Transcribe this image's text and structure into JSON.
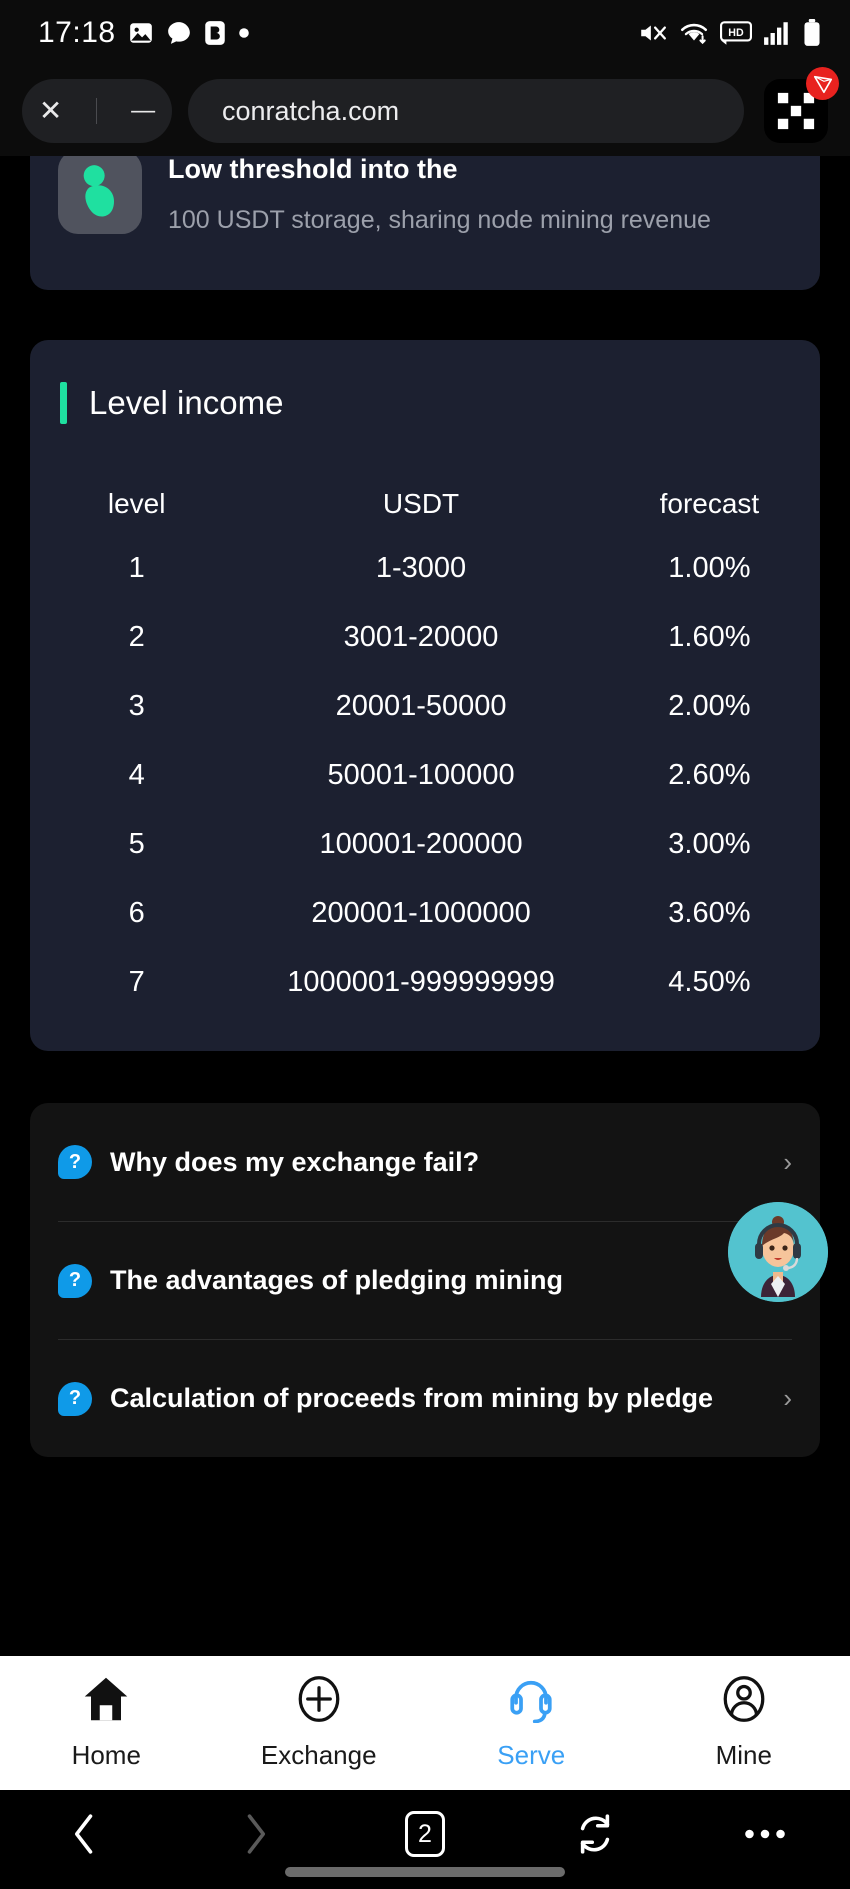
{
  "statusbar": {
    "time": "17:18",
    "left_icons": [
      "photo-icon",
      "chat-icon",
      "b-app-icon",
      "dot-icon"
    ],
    "right_icons": [
      "mute-icon",
      "wifi-icon",
      "hd-icon",
      "signal-icon",
      "battery-icon"
    ]
  },
  "browser_top": {
    "close_label": "✕",
    "minimize_label": "—",
    "url": "conratcha.com",
    "app_launcher_name": "qr-app-icon",
    "badge_name": "tron-badge-icon"
  },
  "promo_card": {
    "title": "Low threshold into the",
    "subtitle": "100 USDT storage, sharing node mining revenue",
    "icon": "person-mining-icon"
  },
  "level_income": {
    "title": "Level income",
    "accent_color": "#1fe0a0"
  },
  "chart_data": {
    "type": "table",
    "title": "Level income",
    "columns": [
      "level",
      "USDT",
      "forecast"
    ],
    "rows": [
      [
        "1",
        "1-3000",
        "1.00%"
      ],
      [
        "2",
        "3001-20000",
        "1.60%"
      ],
      [
        "3",
        "20001-50000",
        "2.00%"
      ],
      [
        "4",
        "50001-100000",
        "2.60%"
      ],
      [
        "5",
        "100001-200000",
        "3.00%"
      ],
      [
        "6",
        "200001-1000000",
        "3.60%"
      ],
      [
        "7",
        "1000001-999999999",
        "4.50%"
      ]
    ]
  },
  "faq": {
    "items": [
      {
        "label": "Why does my exchange fail?",
        "icon": "question-icon",
        "chevron": "›"
      },
      {
        "label": "The advantages of pledging mining",
        "icon": "question-icon",
        "chevron": "›"
      },
      {
        "label": "Calculation of proceeds from mining by pledge",
        "icon": "question-icon",
        "chevron": "›"
      }
    ]
  },
  "service_fab": {
    "name": "customer-service-avatar",
    "bg": "#53c3cf"
  },
  "app_nav": {
    "active_color": "#3aa0f5",
    "items": [
      {
        "label": "Home",
        "icon": "home-icon",
        "active": false
      },
      {
        "label": "Exchange",
        "icon": "plus-circle-icon",
        "active": false
      },
      {
        "label": "Serve",
        "icon": "headset-icon",
        "active": true
      },
      {
        "label": "Mine",
        "icon": "person-circle-icon",
        "active": false
      }
    ]
  },
  "browser_bottom": {
    "back": "back-icon",
    "forward": "forward-icon",
    "tab_count": "2",
    "refresh": "refresh-icon",
    "menu": "more-icon"
  }
}
